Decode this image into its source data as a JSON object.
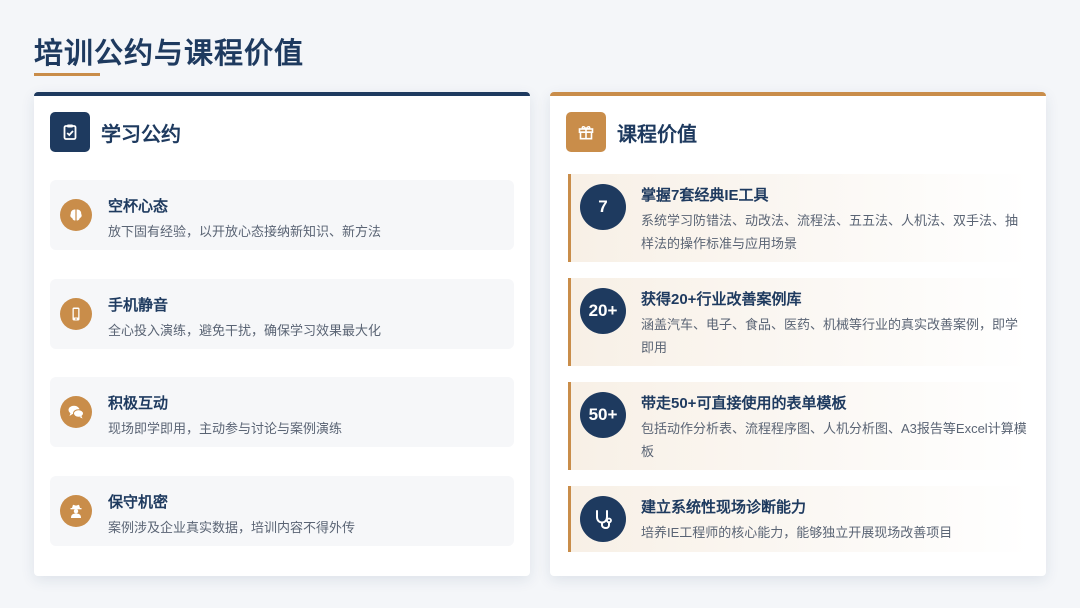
{
  "page": {
    "title": "培训公约与课程价值"
  },
  "left_card": {
    "title": "学习公约",
    "header_icon": "clipboard-check-icon",
    "items": [
      {
        "icon": "brain-icon",
        "title": "空杯心态",
        "desc": "放下固有经验，以开放心态接纳新知识、新方法"
      },
      {
        "icon": "mobile-phone-icon",
        "title": "手机静音",
        "desc": "全心投入演练，避免干扰，确保学习效果最大化"
      },
      {
        "icon": "chat-bubbles-icon",
        "title": "积极互动",
        "desc": "现场即学即用，主动参与讨论与案例演练"
      },
      {
        "icon": "user-secret-icon",
        "title": "保守机密",
        "desc": "案例涉及企业真实数据，培训内容不得外传"
      }
    ]
  },
  "right_card": {
    "title": "课程价值",
    "header_icon": "gift-icon",
    "items": [
      {
        "badge": "7",
        "title": "掌握7套经典IE工具",
        "desc": "系统学习防错法、动改法、流程法、五五法、人机法、双手法、抽样法的操作标准与应用场景"
      },
      {
        "badge": "20+",
        "title": "获得20+行业改善案例库",
        "desc": "涵盖汽车、电子、食品、医药、机械等行业的真实改善案例，即学即用"
      },
      {
        "badge": "50+",
        "title": "带走50+可直接使用的表单模板",
        "desc": "包括动作分析表、流程程序图、人机分析图、A3报告等Excel计算模板"
      },
      {
        "badge_icon": "stethoscope-icon",
        "title": "建立系统性现场诊断能力",
        "desc": "培养IE工程师的核心能力，能够独立开展现场改善项目"
      }
    ]
  },
  "colors": {
    "navy": "#1e3a5f",
    "gold": "#c98d4a",
    "background": "#f4f6f9"
  }
}
